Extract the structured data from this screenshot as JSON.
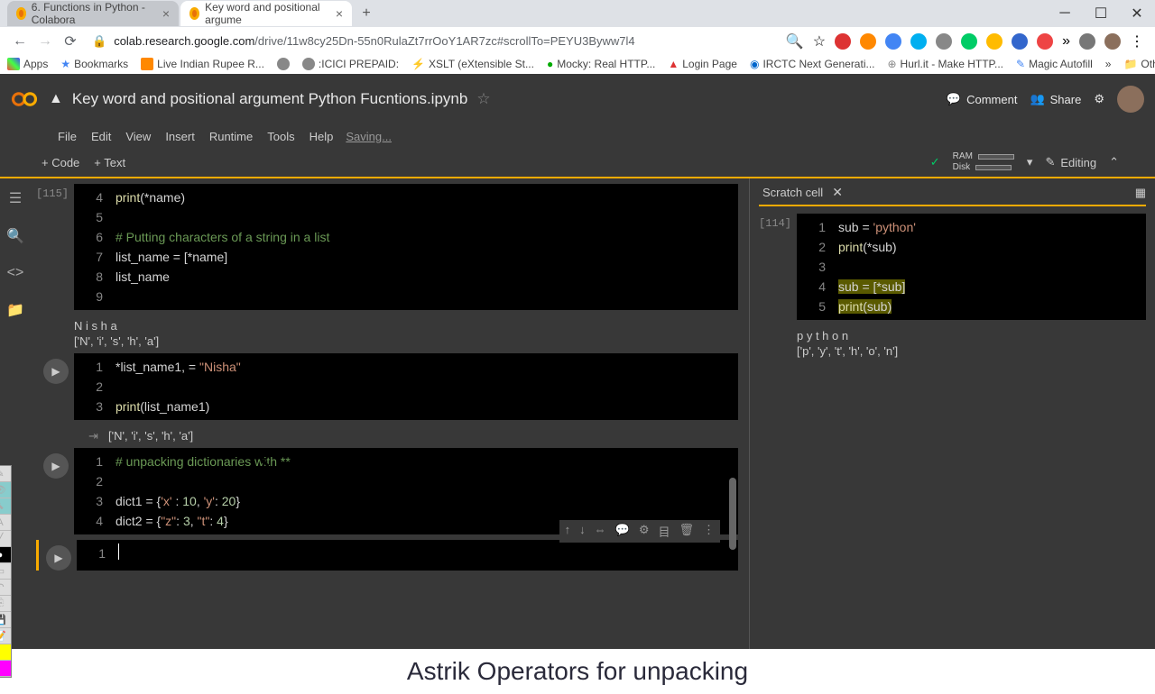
{
  "browser": {
    "tabs": [
      {
        "title": "6. Functions in Python - Colabora"
      },
      {
        "title": "Key word and positional argume"
      }
    ],
    "url_prefix": "colab.research.google.com",
    "url_path": "/drive/11w8cy25Dn-55n0RulaZt7rrOoY1AR7zc#scrollTo=PEYU3Byww7l4",
    "bookmarks": [
      "Apps",
      "Bookmarks",
      "Live Indian Rupee R...",
      "",
      ":ICICI PREPAID:",
      "XSLT (eXtensible St...",
      "Mocky: Real HTTP...",
      "Login Page",
      "IRCTC Next Generati...",
      "Hurl.it - Make HTTP...",
      "Magic Autofill",
      "Other bookmarks"
    ]
  },
  "colab": {
    "title": "Key word and positional argument Python Fucntions.ipynb",
    "menus": [
      "File",
      "Edit",
      "View",
      "Insert",
      "Runtime",
      "Tools",
      "Help"
    ],
    "saving": "Saving...",
    "toolbar": {
      "code": "+  Code",
      "text": "+  Text",
      "editing": "Editing"
    },
    "ram": "RAM",
    "disk": "Disk",
    "comment": "Comment",
    "share": "Share"
  },
  "cells": {
    "c1": {
      "exec": "[115]",
      "lines": [
        "print(*name)",
        "",
        "# Putting characters of a string in a list",
        "list_name = [*name]",
        "list_name",
        ""
      ],
      "out1": "N i s h a",
      "out2": "['N', 'i', 's', 'h', 'a']"
    },
    "c2": {
      "lines": [
        "*list_name1, = \"Nisha\"",
        "",
        "print(list_name1)"
      ],
      "out": "['N', 'i', 's', 'h', 'a']"
    },
    "c3": {
      "lines": [
        "# unpacking dictionaries with **",
        "",
        "dict1 = {'x' : 10, 'y': 20}",
        "dict2 = {\"z\": 3, \"t\": 4}"
      ]
    }
  },
  "scratch": {
    "title": "Scratch cell",
    "exec": "[114]",
    "lines": [
      "sub = 'python'",
      "print(*sub)",
      "",
      "sub = [*sub]",
      "print(sub)"
    ],
    "out1": "p y t h o n",
    "out2": "['p', 'y', 't', 'h', 'o', 'n']"
  },
  "footer": "Astrik Operators for unpacking"
}
